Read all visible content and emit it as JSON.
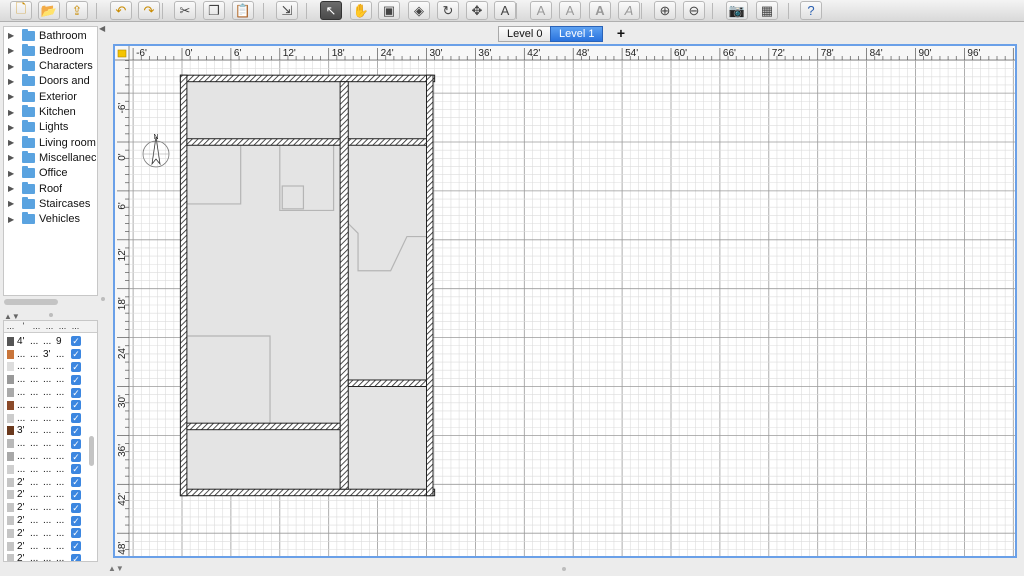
{
  "toolbar": {
    "buttons": [
      {
        "name": "new-home-button",
        "glyph": "🗋"
      },
      {
        "name": "open-button",
        "glyph": "📂"
      },
      {
        "name": "save-button",
        "glyph": "⇪"
      },
      {
        "name": "undo-button",
        "glyph": "↶"
      },
      {
        "name": "redo-button",
        "glyph": "↷"
      },
      {
        "name": "cut-button",
        "glyph": "✂"
      },
      {
        "name": "copy-button",
        "glyph": "❐"
      },
      {
        "name": "paste-button",
        "glyph": "📋"
      },
      {
        "name": "add-furniture-button",
        "glyph": "⇲"
      },
      {
        "name": "select-mode-button",
        "glyph": "↖"
      },
      {
        "name": "pan-mode-button",
        "glyph": "✋"
      },
      {
        "name": "create-walls-button",
        "glyph": "▣"
      },
      {
        "name": "create-rooms-button",
        "glyph": "◈"
      },
      {
        "name": "create-polylines-button",
        "glyph": "↻"
      },
      {
        "name": "create-dimensions-button",
        "glyph": "✥"
      },
      {
        "name": "add-text-button",
        "glyph": "A"
      },
      {
        "name": "text-style-1-button",
        "glyph": "A"
      },
      {
        "name": "text-style-2-button",
        "glyph": "A"
      },
      {
        "name": "text-bold-button",
        "glyph": "A"
      },
      {
        "name": "text-italic-button",
        "glyph": "A"
      },
      {
        "name": "zoom-in-button",
        "glyph": "⊕"
      },
      {
        "name": "zoom-out-button",
        "glyph": "⊖"
      },
      {
        "name": "create-photo-button",
        "glyph": "📷"
      },
      {
        "name": "create-video-button",
        "glyph": "▦"
      },
      {
        "name": "help-button",
        "glyph": "?"
      }
    ]
  },
  "catalog": {
    "categories": [
      "Bathroom",
      "Bedroom",
      "Characters",
      "Doors and",
      "Exterior",
      "Kitchen",
      "Lights",
      "Living room",
      "Miscellanec",
      "Office",
      "Roof",
      "Staircases",
      "Vehicles"
    ]
  },
  "furniture": {
    "header": [
      "...",
      "'",
      "...",
      "...",
      "...",
      "..."
    ],
    "rows": [
      {
        "c1": "4'",
        "c2": "...",
        "c3": "...",
        "c4": "9",
        "thumb": "#555555"
      },
      {
        "c1": "...",
        "c2": "...",
        "c3": "3'",
        "c4": "...",
        "thumb": "#c9753a"
      },
      {
        "c1": "...",
        "c2": "...",
        "c3": "...",
        "c4": "...",
        "thumb": "#dddddd"
      },
      {
        "c1": "...",
        "c2": "...",
        "c3": "...",
        "c4": "...",
        "thumb": "#999999"
      },
      {
        "c1": "...",
        "c2": "...",
        "c3": "...",
        "c4": "...",
        "thumb": "#aaaaaa"
      },
      {
        "c1": "...",
        "c2": "...",
        "c3": "...",
        "c4": "...",
        "thumb": "#8b4a2a"
      },
      {
        "c1": "...",
        "c2": "...",
        "c3": "...",
        "c4": "...",
        "thumb": "#cccccc"
      },
      {
        "c1": "3'",
        "c2": "...",
        "c3": "...",
        "c4": "...",
        "thumb": "#6b3a1e"
      },
      {
        "c1": "...",
        "c2": "...",
        "c3": "...",
        "c4": "...",
        "thumb": "#b9b9b9"
      },
      {
        "c1": "...",
        "c2": "...",
        "c3": "...",
        "c4": "...",
        "thumb": "#a8a8a8"
      },
      {
        "c1": "...",
        "c2": "...",
        "c3": "...",
        "c4": "...",
        "thumb": "#cfcfcf"
      },
      {
        "c1": "2'",
        "c2": "...",
        "c3": "...",
        "c4": "...",
        "thumb": "#c5c5c5"
      },
      {
        "c1": "2'",
        "c2": "...",
        "c3": "...",
        "c4": "...",
        "thumb": "#c5c5c5"
      },
      {
        "c1": "2'",
        "c2": "...",
        "c3": "...",
        "c4": "...",
        "thumb": "#c5c5c5"
      },
      {
        "c1": "2'",
        "c2": "...",
        "c3": "...",
        "c4": "...",
        "thumb": "#c5c5c5"
      },
      {
        "c1": "2'",
        "c2": "...",
        "c3": "...",
        "c4": "...",
        "thumb": "#c5c5c5"
      },
      {
        "c1": "2'",
        "c2": "...",
        "c3": "...",
        "c4": "...",
        "thumb": "#c5c5c5"
      },
      {
        "c1": "2'",
        "c2": "...",
        "c3": "...",
        "c4": "...",
        "thumb": "#c5c5c5"
      }
    ]
  },
  "levels": {
    "tabs": [
      "Level 0",
      "Level 1"
    ],
    "active": 1,
    "add_label": "+"
  },
  "plan": {
    "ruler_x": [
      "-6'",
      "0'",
      "6'",
      "12'",
      "18'",
      "24'",
      "30'",
      "36'",
      "42'",
      "48'",
      "54'",
      "60'",
      "66'",
      "72'",
      "78'",
      "84'",
      "90'",
      "96'"
    ],
    "ruler_y": [
      "-6'",
      "0'",
      "6'",
      "12'",
      "18'",
      "24'",
      "30'",
      "36'",
      "42'",
      "48'"
    ],
    "compass_label": "N",
    "colors": {
      "accent": "#6aa0e8",
      "grid": "#dcdcdc",
      "grid_major": "#9a9a9a",
      "room": "#e4e4e4",
      "wall": "#222222"
    }
  }
}
